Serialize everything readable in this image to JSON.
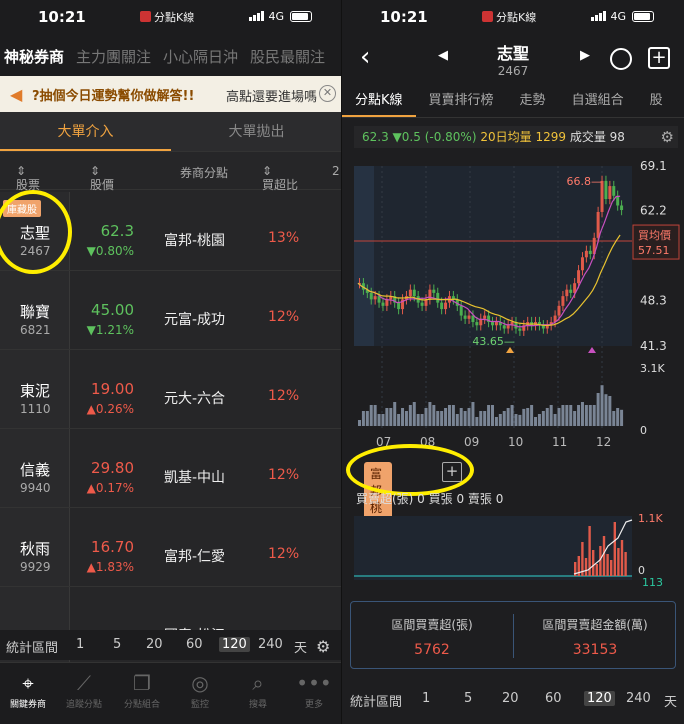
{
  "status": {
    "time": "10:21",
    "app": "分點K線",
    "network": "4G"
  },
  "left": {
    "topnav": [
      "神秘券商",
      "主力團關注",
      "小心隔日沖",
      "股民最關注"
    ],
    "banner": {
      "text1": "?抽個今日運勢幫你做解答!!",
      "text2": "高點還要進場嗎"
    },
    "subtabs": [
      "大單介入",
      "大單拋出"
    ],
    "headers": [
      "股票",
      "股價",
      "券商分點",
      "買超比",
      "2"
    ],
    "rows": [
      {
        "tag": "庫藏股",
        "name": "志聖",
        "code": "2467",
        "price": "62.3",
        "change": "▼0.80%",
        "dir": "dn",
        "broker": "富邦-桃園",
        "ratio": "13%"
      },
      {
        "tag": "",
        "name": "聯寶",
        "code": "6821",
        "price": "45.00",
        "change": "▼1.21%",
        "dir": "dn",
        "broker": "元富-成功",
        "ratio": "12%"
      },
      {
        "tag": "",
        "name": "東泥",
        "code": "1110",
        "price": "19.00",
        "change": "▲0.26%",
        "dir": "up",
        "broker": "元大-六合",
        "ratio": "12%"
      },
      {
        "tag": "",
        "name": "信義",
        "code": "9940",
        "price": "29.80",
        "change": "▲0.17%",
        "dir": "up",
        "broker": "凱基-中山",
        "ratio": "12%"
      },
      {
        "tag": "",
        "name": "秋雨",
        "code": "9929",
        "price": "16.70",
        "change": "▲1.83%",
        "dir": "up",
        "broker": "富邦-仁愛",
        "ratio": "12%"
      },
      {
        "tag": "",
        "name": "",
        "code": "",
        "price": "",
        "change": "",
        "dir": "up",
        "broker": "國泰-松江",
        "ratio": ""
      }
    ],
    "period": {
      "label": "統計區間",
      "options": [
        "1",
        "5",
        "20",
        "60",
        "120",
        "240",
        "天"
      ],
      "selected": "120"
    },
    "bottomnav": [
      {
        "label": "關鍵券商",
        "icon": "location-pin-icon"
      },
      {
        "label": "追蹤分點",
        "icon": "line-chart-icon"
      },
      {
        "label": "分點組合",
        "icon": "stack-icon"
      },
      {
        "label": "監控",
        "icon": "radar-icon"
      },
      {
        "label": "搜尋",
        "icon": "search-icon"
      },
      {
        "label": "更多",
        "icon": "more-icon"
      }
    ]
  },
  "right": {
    "title": "志聖",
    "code": "2467",
    "tabs": [
      "分點K線",
      "買賣排行榜",
      "走勢",
      "自選組合",
      "股"
    ],
    "info": {
      "price": "62.3",
      "change": "▼0.5",
      "pct": "(-0.80%)",
      "ma_label": "20日均量",
      "ma_value": "1299",
      "vol_label": "成交量",
      "vol_value": "98"
    },
    "chart_data": {
      "type": "candlestick",
      "x_labels": [
        "07",
        "08",
        "09",
        "10",
        "11",
        "12"
      ],
      "y_ticks": [
        "69.1",
        "62.2",
        "48.3",
        "41.3"
      ],
      "volume_ticks": [
        "3.1K",
        "0"
      ],
      "high_label": "66.8",
      "low_label": "43.65",
      "avg_price_label": "買均價",
      "avg_price": "57.51",
      "close": [
        51,
        50,
        49.5,
        48.5,
        49,
        48,
        47.5,
        48.5,
        49,
        48,
        47,
        48.5,
        49,
        50,
        49,
        48,
        47.5,
        48.5,
        50,
        49.5,
        48,
        47,
        48,
        49,
        48.5,
        47.5,
        46,
        45.5,
        46,
        45,
        44.5,
        45.5,
        46,
        45,
        44.5,
        45,
        44.5,
        44,
        44.5,
        45,
        44,
        43.65,
        44.5,
        45,
        44.5,
        45,
        44.5,
        44,
        44.5,
        45,
        46,
        47.5,
        49,
        50,
        49.5,
        51,
        53,
        55,
        56,
        55.5,
        58,
        62,
        66.8,
        64,
        66,
        64.5,
        63,
        62.3
      ]
    },
    "broker": "富邦-桃園",
    "bs_line": "買賣超(張) 0  買張 0  賣張 0",
    "net_ticks": [
      "1.1K",
      "0",
      "113"
    ],
    "summary": [
      {
        "label": "區間買賣超(張)",
        "value": "5762"
      },
      {
        "label": "區間買賣超金額(萬)",
        "value": "33153"
      }
    ],
    "period": {
      "label": "統計區間",
      "options": [
        "1",
        "5",
        "20",
        "60",
        "120",
        "240",
        "天"
      ],
      "selected": "120"
    }
  }
}
